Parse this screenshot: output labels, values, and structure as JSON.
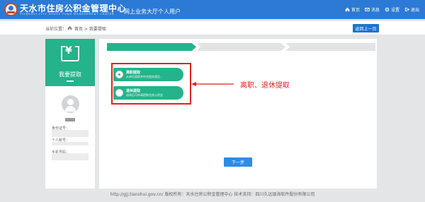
{
  "header": {
    "title": "天水市住房公积金管理中心",
    "subtitle_en": "TIANSHUI CITY HOUSE FUND MANAGEMENT CENTER",
    "hall": "网上业务大厅",
    "role": "个人用户",
    "nav": [
      {
        "label": "首页",
        "icon": "home-icon"
      },
      {
        "label": "消息",
        "icon": "mail-icon"
      },
      {
        "label": "设置",
        "icon": "gear-icon"
      },
      {
        "label": "退出",
        "icon": "logout-icon"
      }
    ]
  },
  "breadcrumb": {
    "label": "当前位置：",
    "path": "首页 > 我要提取",
    "back_button": "返回上一页"
  },
  "sidebar": {
    "title": "我要提取",
    "fields": [
      "身份证号：",
      "个人账号：",
      "手机号码："
    ]
  },
  "wizard": {
    "steps": [
      "",
      "",
      ""
    ],
    "active_step": 1
  },
  "options": [
    {
      "title": "离职提取",
      "desc": "从单位离职并符合相关规定...",
      "selected": true
    },
    {
      "title": "退休提取",
      "desc": "退休后可申请提取住房公积金",
      "selected": false
    }
  ],
  "annotation": "离职、退休提取",
  "next_button": "下一步",
  "footer": "http://gjj.tianshui.gov.cn/ 版权所有：天水住房公积金管理中心 技术支持：四川久远银海软件股份有限公司",
  "colors": {
    "header_blue": "#2c7ad5",
    "accent_green": "#24b38a",
    "annotation_red": "#e0211d"
  }
}
